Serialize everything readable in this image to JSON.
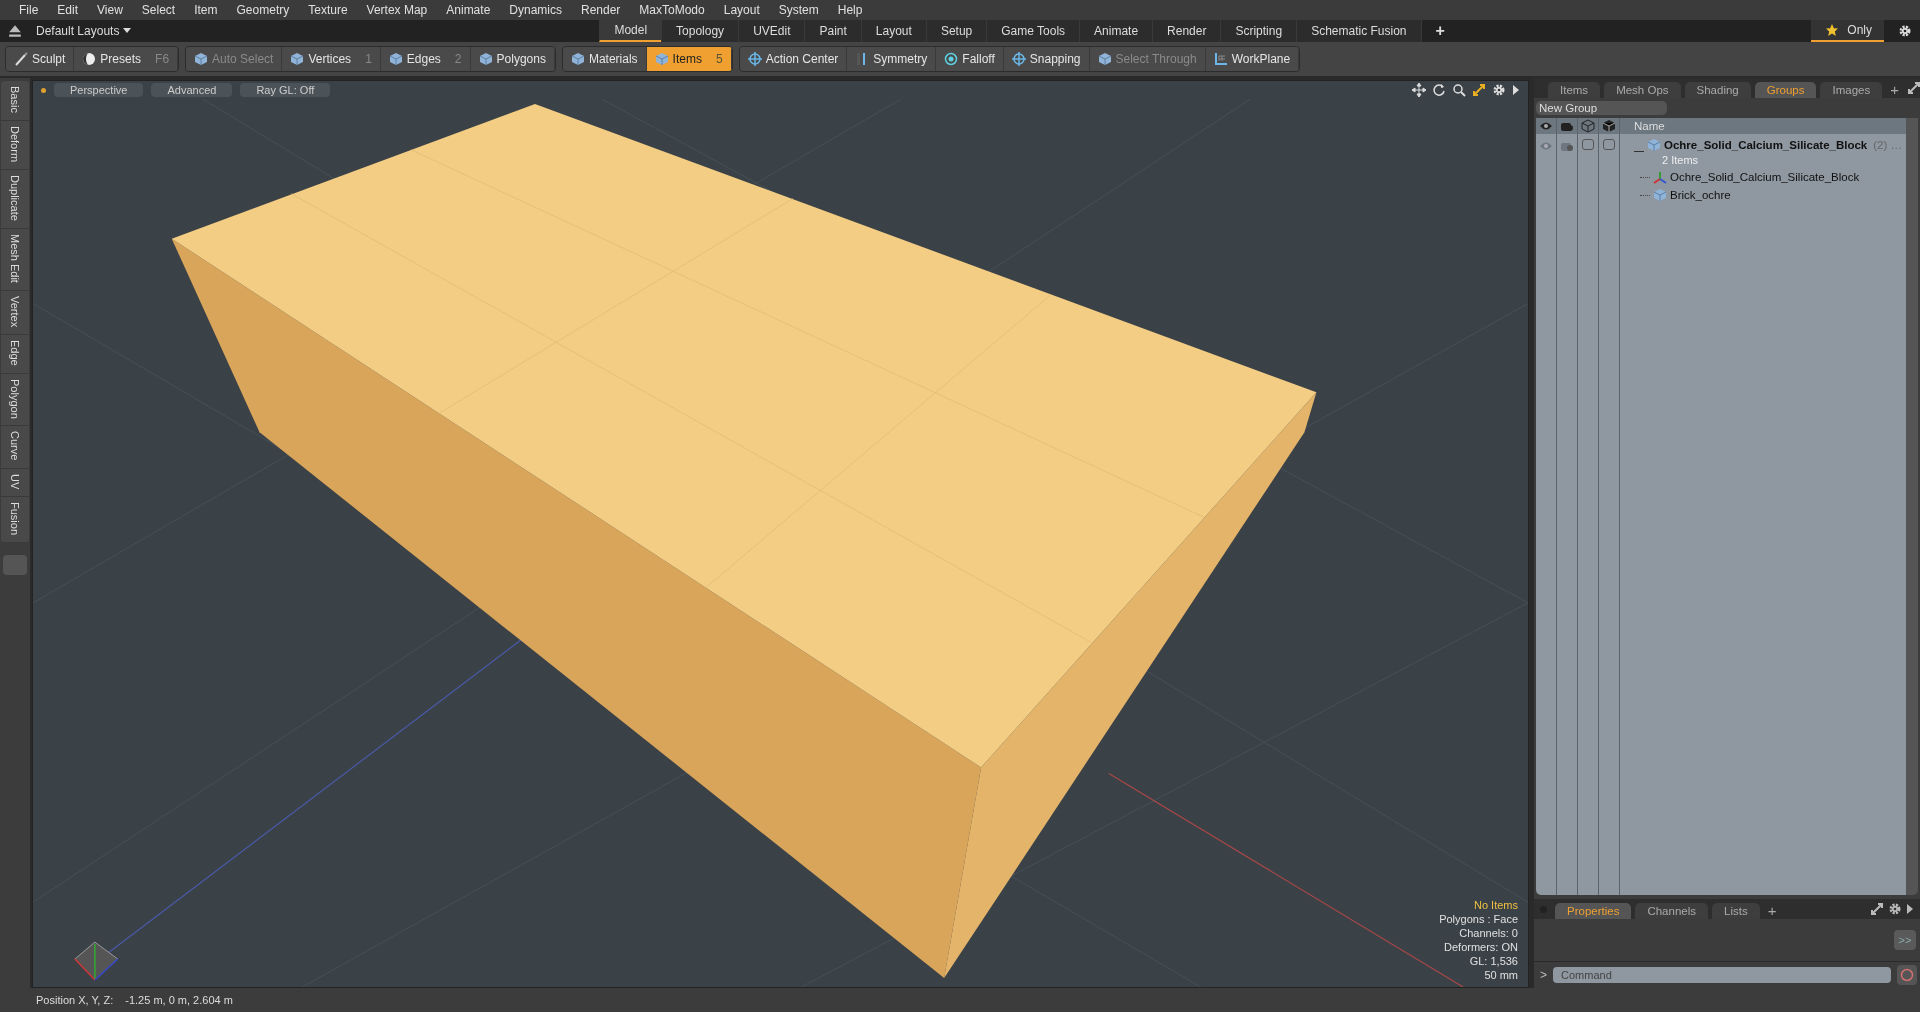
{
  "menu": [
    "File",
    "Edit",
    "View",
    "Select",
    "Item",
    "Geometry",
    "Texture",
    "Vertex Map",
    "Animate",
    "Dynamics",
    "Render",
    "MaxToModo",
    "Layout",
    "System",
    "Help"
  ],
  "layout_bar": {
    "layout_menu": "Default Layouts",
    "tabs": [
      {
        "label": "Model",
        "selected": true
      },
      {
        "label": "Topology",
        "selected": false
      },
      {
        "label": "UVEdit",
        "selected": false
      },
      {
        "label": "Paint",
        "selected": false
      },
      {
        "label": "Layout",
        "selected": false
      },
      {
        "label": "Setup",
        "selected": false
      },
      {
        "label": "Game Tools",
        "selected": false
      },
      {
        "label": "Animate",
        "selected": false
      },
      {
        "label": "Render",
        "selected": false
      },
      {
        "label": "Scripting",
        "selected": false
      },
      {
        "label": "Schematic Fusion",
        "selected": false
      }
    ],
    "add": "+",
    "only": "Only"
  },
  "toolbar": [
    [
      {
        "label": "Sculpt",
        "kind": "brush",
        "selected": false,
        "disabled": false
      },
      {
        "label": "Presets",
        "shortcut": "F6",
        "kind": "sphere",
        "selected": false,
        "disabled": false
      }
    ],
    [
      {
        "label": "Auto Select",
        "kind": "cube",
        "selected": false,
        "disabled": true
      },
      {
        "label": "Vertices",
        "shortcut": "1",
        "kind": "cube",
        "selected": false,
        "disabled": false
      },
      {
        "label": "Edges",
        "shortcut": "2",
        "kind": "cube",
        "selected": false,
        "disabled": false
      },
      {
        "label": "Polygons",
        "kind": "cube",
        "selected": false,
        "disabled": false
      }
    ],
    [
      {
        "label": "Materials",
        "kind": "cube",
        "selected": false,
        "disabled": false
      },
      {
        "label": "Items",
        "shortcut": "5",
        "kind": "cube",
        "selected": true,
        "disabled": false
      }
    ],
    [
      {
        "label": "Action Center",
        "kind": "crosshair",
        "selected": false,
        "disabled": false
      },
      {
        "label": "Symmetry",
        "kind": "bar",
        "selected": false,
        "disabled": false
      },
      {
        "label": "Falloff",
        "kind": "ring",
        "selected": false,
        "disabled": false
      },
      {
        "label": "Snapping",
        "kind": "crosshair",
        "selected": false,
        "disabled": false
      },
      {
        "label": "Select Through",
        "kind": "cube",
        "selected": false,
        "disabled": true
      },
      {
        "label": "WorkPlane",
        "kind": "grid",
        "selected": false,
        "disabled": false
      }
    ]
  ],
  "left_tabs": [
    "Basic",
    "Deform",
    "Duplicate",
    "Mesh Edit",
    "Vertex",
    "Edge",
    "Polygon",
    "Curve",
    "UV",
    "Fusion"
  ],
  "viewport": {
    "header": [
      "Perspective",
      "Advanced",
      "Ray GL: Off"
    ],
    "info": [
      {
        "text": "No Items",
        "highlight": true
      },
      {
        "text": "Polygons : Face",
        "highlight": false
      },
      {
        "text": "Channels: 0",
        "highlight": false
      },
      {
        "text": "Deformers: ON",
        "highlight": false
      },
      {
        "text": "GL: 1,536",
        "highlight": false
      },
      {
        "text": "50 mm",
        "highlight": false
      }
    ]
  },
  "status_bar": {
    "label": "Position X, Y, Z:",
    "value": "-1.25 m, 0 m, 2.604 m"
  },
  "right_panel": {
    "tabs": [
      {
        "label": "Items",
        "selected": false
      },
      {
        "label": "Mesh Ops",
        "selected": false
      },
      {
        "label": "Shading",
        "selected": false
      },
      {
        "label": "Groups",
        "selected": true
      },
      {
        "label": "Images",
        "selected": false
      }
    ],
    "add": "+",
    "new_group": "New Group",
    "name_column": "Name",
    "group": {
      "name": "Ochre_Solid_Calcium_Silicate_Block",
      "count": "(2) …",
      "toggles": [
        {
          "checked": false
        },
        {
          "checked": false
        }
      ],
      "subtitle": "2 Items",
      "children": [
        {
          "name": "Ochre_Solid_Calcium_Silicate_Block",
          "kind": "locator"
        },
        {
          "name": "Brick_ochre",
          "kind": "mesh"
        }
      ]
    },
    "bottom_tabs": [
      {
        "label": "Properties",
        "selected": true
      },
      {
        "label": "Channels",
        "selected": false
      },
      {
        "label": "Lists",
        "selected": false
      }
    ],
    "bottom_add": "+",
    "expand_button": ">>",
    "prompt": ">",
    "command_placeholder": "Command"
  }
}
